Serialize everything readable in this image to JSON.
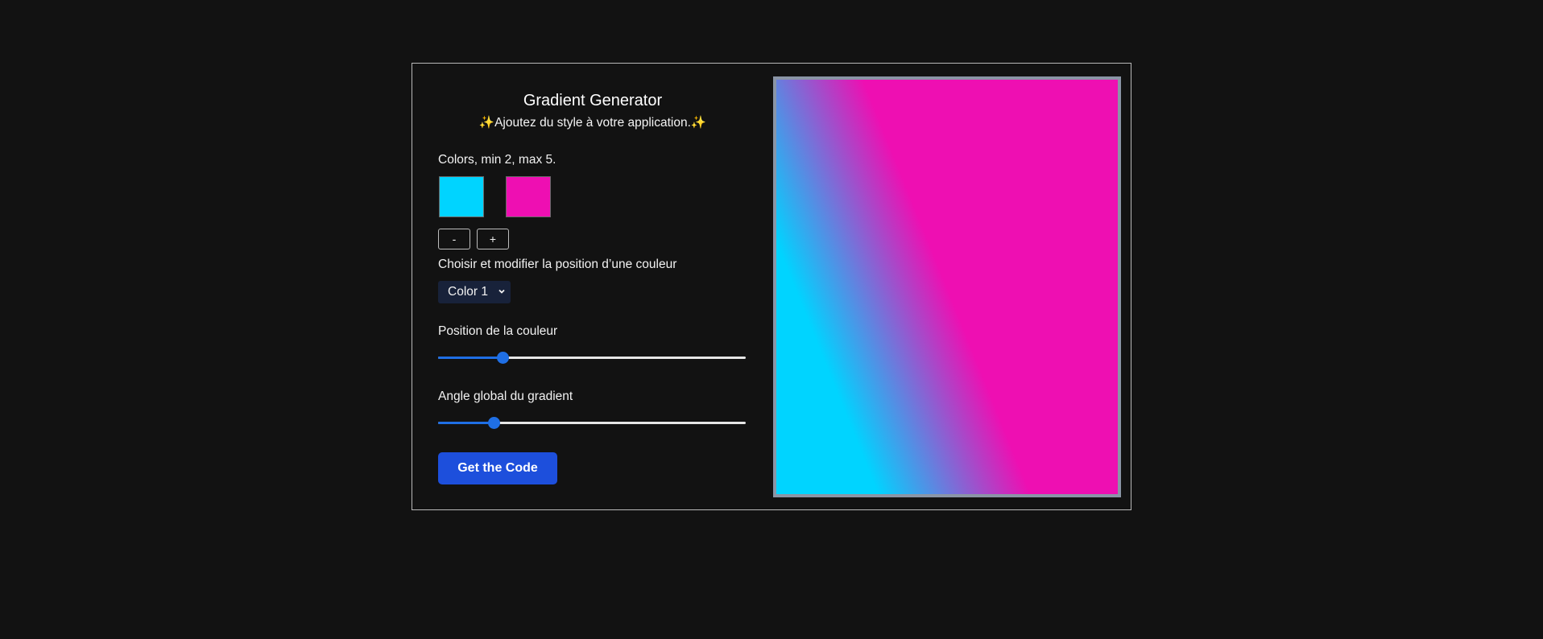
{
  "header": {
    "title": "Gradient Generator",
    "subtitle_left_icon": "sparkles-icon",
    "subtitle_text": "Ajoutez du style à votre application.",
    "subtitle_right_icon": "sparkles-icon"
  },
  "colors": {
    "label": "Colors, min 2, max 5.",
    "swatches": [
      {
        "color": "#00d4ff"
      },
      {
        "color": "#ee0fb2"
      }
    ],
    "remove_label": "-",
    "add_label": "+"
  },
  "selector": {
    "label": "Choisir et modifier la position d’une couleur",
    "selected": "Color 1"
  },
  "position": {
    "label": "Position de la couleur",
    "value_fraction": 0.21
  },
  "angle": {
    "label": "Angle global du gradient",
    "value_fraction": 0.18
  },
  "actions": {
    "get_code_label": "Get the Code"
  },
  "theme": {
    "background": "#121212",
    "accent": "#1f6fe5",
    "button": "#1d4fdc",
    "preview_border": "#8a95a6"
  }
}
